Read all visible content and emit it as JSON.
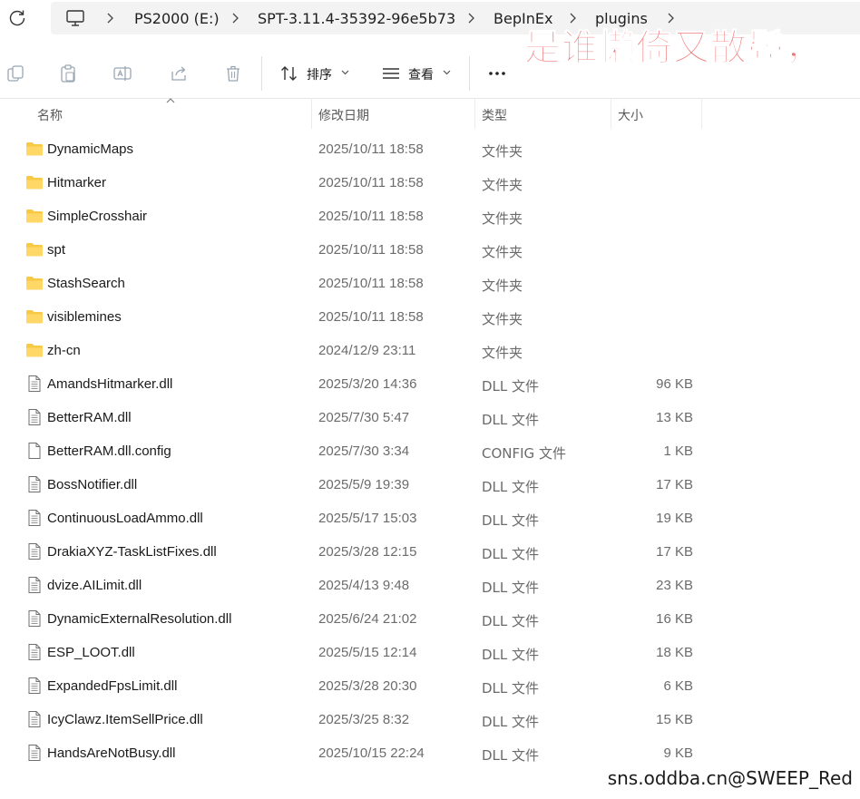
{
  "breadcrumb": {
    "items": [
      "PS2000 (E:)",
      "SPT-3.11.4-35392-96e5b73",
      "BepInEx",
      "plugins"
    ]
  },
  "toolbar": {
    "sort_label": "排序",
    "view_label": "查看",
    "more_label": "..."
  },
  "columns": {
    "name": "名称",
    "date": "修改日期",
    "type": "类型",
    "size": "大小"
  },
  "files": [
    {
      "name": "DynamicMaps",
      "date": "2025/10/11 18:58",
      "type": "文件夹",
      "size": "",
      "icon": "folder-icon"
    },
    {
      "name": "Hitmarker",
      "date": "2025/10/11 18:58",
      "type": "文件夹",
      "size": "",
      "icon": "folder-icon"
    },
    {
      "name": "SimpleCrosshair",
      "date": "2025/10/11 18:58",
      "type": "文件夹",
      "size": "",
      "icon": "folder-icon"
    },
    {
      "name": "spt",
      "date": "2025/10/11 18:58",
      "type": "文件夹",
      "size": "",
      "icon": "folder-icon"
    },
    {
      "name": "StashSearch",
      "date": "2025/10/11 18:58",
      "type": "文件夹",
      "size": "",
      "icon": "folder-icon"
    },
    {
      "name": "visiblemines",
      "date": "2025/10/11 18:58",
      "type": "文件夹",
      "size": "",
      "icon": "folder-icon"
    },
    {
      "name": "zh-cn",
      "date": "2024/12/9 23:11",
      "type": "文件夹",
      "size": "",
      "icon": "folder-icon"
    },
    {
      "name": "AmandsHitmarker.dll",
      "date": "2025/3/20 14:36",
      "type": "DLL 文件",
      "size": "96 KB",
      "icon": "dll-file-icon"
    },
    {
      "name": "BetterRAM.dll",
      "date": "2025/7/30 5:47",
      "type": "DLL 文件",
      "size": "13 KB",
      "icon": "dll-file-icon"
    },
    {
      "name": "BetterRAM.dll.config",
      "date": "2025/7/30 3:34",
      "type": "CONFIG 文件",
      "size": "1 KB",
      "icon": "blank-file-icon"
    },
    {
      "name": "BossNotifier.dll",
      "date": "2025/5/9 19:39",
      "type": "DLL 文件",
      "size": "17 KB",
      "icon": "dll-file-icon"
    },
    {
      "name": "ContinuousLoadAmmo.dll",
      "date": "2025/5/17 15:03",
      "type": "DLL 文件",
      "size": "19 KB",
      "icon": "dll-file-icon"
    },
    {
      "name": "DrakiaXYZ-TaskListFixes.dll",
      "date": "2025/3/28 12:15",
      "type": "DLL 文件",
      "size": "17 KB",
      "icon": "dll-file-icon"
    },
    {
      "name": "dvize.AILimit.dll",
      "date": "2025/4/13 9:48",
      "type": "DLL 文件",
      "size": "23 KB",
      "icon": "dll-file-icon"
    },
    {
      "name": "DynamicExternalResolution.dll",
      "date": "2025/6/24 21:02",
      "type": "DLL 文件",
      "size": "16 KB",
      "icon": "dll-file-icon"
    },
    {
      "name": "ESP_LOOT.dll",
      "date": "2025/5/15 12:14",
      "type": "DLL 文件",
      "size": "18 KB",
      "icon": "dll-file-icon"
    },
    {
      "name": "ExpandedFpsLimit.dll",
      "date": "2025/3/28 20:30",
      "type": "DLL 文件",
      "size": "6 KB",
      "icon": "dll-file-icon"
    },
    {
      "name": "IcyClawz.ItemSellPrice.dll",
      "date": "2025/3/25 8:32",
      "type": "DLL 文件",
      "size": "15 KB",
      "icon": "dll-file-icon"
    },
    {
      "name": "HandsAreNotBusy.dll",
      "date": "2025/10/15 22:24",
      "type": "DLL 文件",
      "size": "9 KB",
      "icon": "dll-file-icon"
    }
  ],
  "watermarks": {
    "top": "是谁懒倚又散鬓，",
    "bottom": "sns.oddba.cn@SWEEP_Red"
  },
  "colors": {
    "folder": "#f8c945",
    "watermark_top": "#ec5c5c"
  }
}
